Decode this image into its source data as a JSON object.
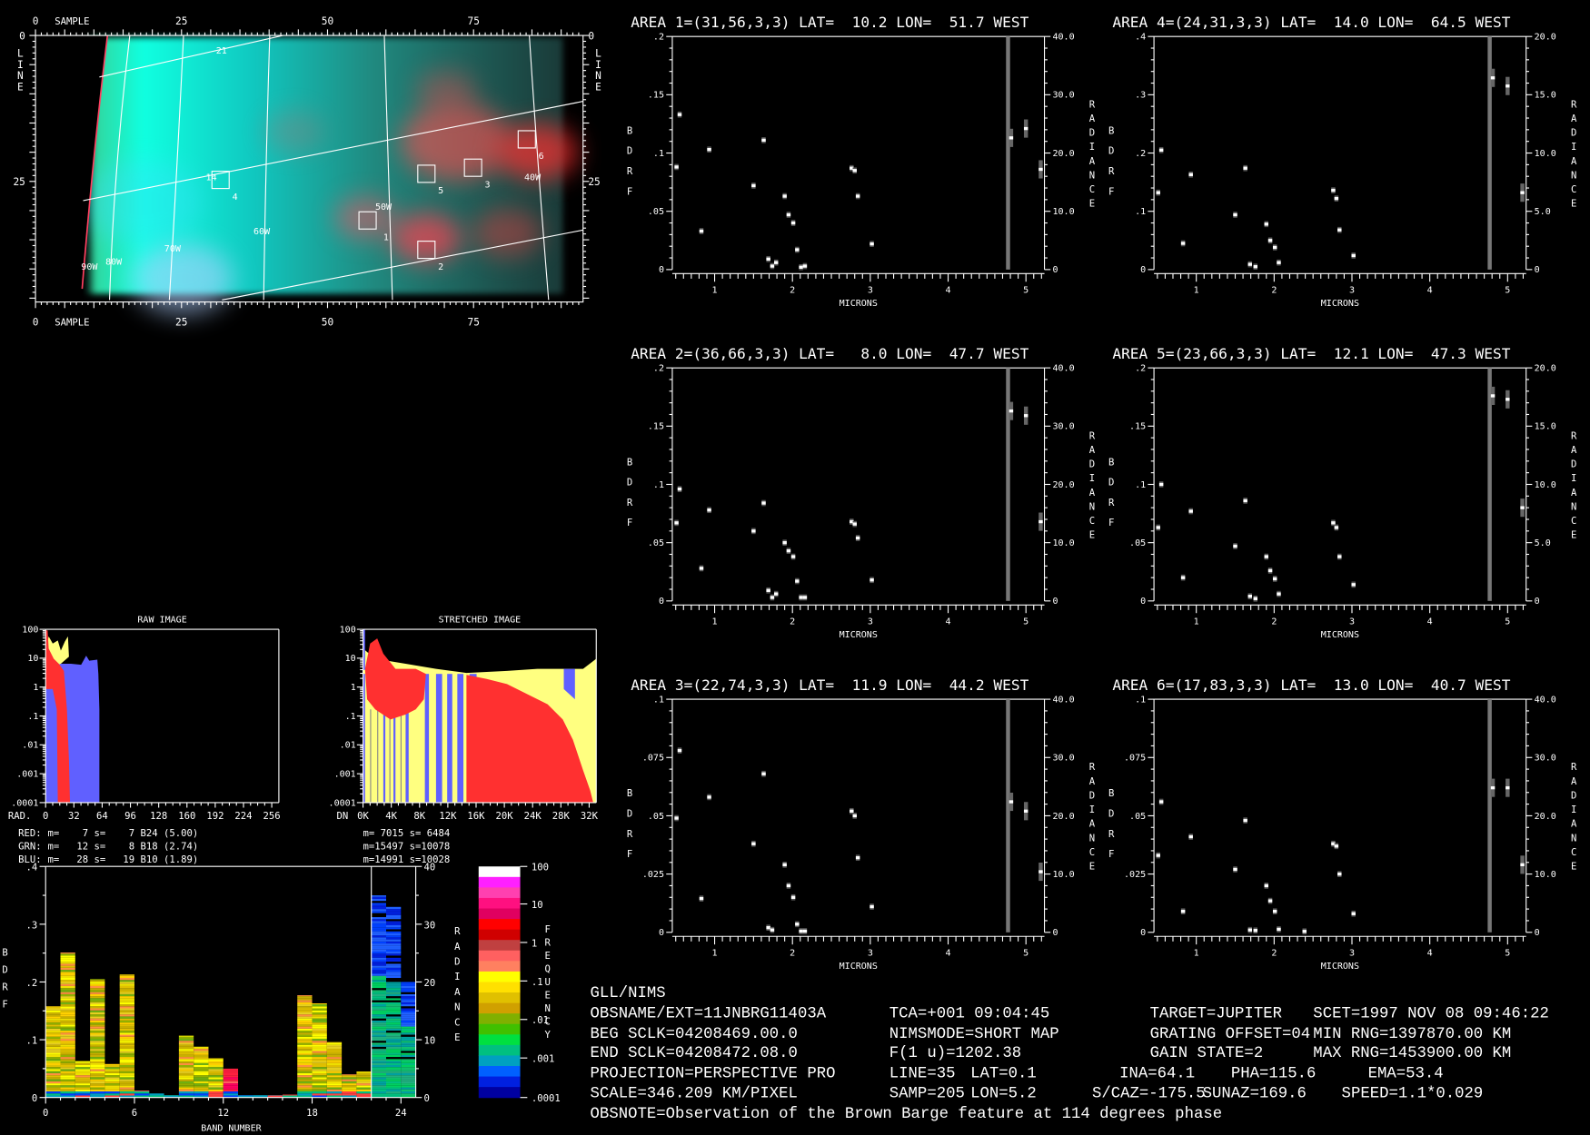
{
  "map": {
    "sample_label": "SAMPLE",
    "line_label": [
      "L",
      "I",
      "N",
      "E"
    ],
    "sample_ticks": [
      "0",
      "25",
      "50",
      "75"
    ],
    "line_ticks": [
      "0",
      "25"
    ],
    "lon_labels": [
      "90W",
      "80W",
      "70W",
      "60W",
      "50W",
      "40W"
    ],
    "lat_labels": [
      "21",
      "14"
    ],
    "areas": [
      "1",
      "2",
      "3",
      "4",
      "5",
      "6"
    ]
  },
  "spectra": {
    "xlabel": "MICRONS",
    "left_label": [
      "B",
      "D",
      "R",
      "F"
    ],
    "right_label": [
      "R",
      "A",
      "D",
      "I",
      "A",
      "N",
      "C",
      "E"
    ],
    "x_ticks": [
      "1",
      "2",
      "3",
      "4",
      "5"
    ],
    "thermal_band_micron": 4.77,
    "areas": [
      {
        "title": "AREA 1=(31,56,3,3) LAT=  10.2 LON=  51.7 WEST",
        "yticks": [
          "0",
          ".05",
          ".1",
          ".15",
          ".2"
        ],
        "ymax": 0.2,
        "rticks": [
          "0",
          "10.0",
          "20.0",
          "30.0",
          "40.0"
        ],
        "points": [
          [
            0.51,
            0.088
          ],
          [
            0.55,
            0.133
          ],
          [
            0.83,
            0.033
          ],
          [
            0.93,
            0.103
          ],
          [
            1.5,
            0.072
          ],
          [
            1.63,
            0.111
          ],
          [
            1.69,
            0.009
          ],
          [
            1.74,
            0.003
          ],
          [
            1.79,
            0.006
          ],
          [
            1.9,
            0.063
          ],
          [
            1.95,
            0.047
          ],
          [
            2.01,
            0.04
          ],
          [
            2.06,
            0.017
          ],
          [
            2.11,
            0.002
          ],
          [
            2.16,
            0.003
          ],
          [
            2.76,
            0.087
          ],
          [
            2.8,
            0.085
          ],
          [
            2.84,
            0.063
          ],
          [
            3.02,
            0.022
          ],
          [
            4.81,
            0.113
          ],
          [
            5.0,
            0.121
          ],
          [
            5.19,
            0.086
          ]
        ]
      },
      {
        "title": "AREA 2=(36,66,3,3) LAT=   8.0 LON=  47.7 WEST",
        "yticks": [
          "0",
          ".05",
          ".1",
          ".15",
          ".2"
        ],
        "ymax": 0.2,
        "rticks": [
          "0",
          "10.0",
          "20.0",
          "30.0",
          "40.0"
        ],
        "points": [
          [
            0.51,
            0.067
          ],
          [
            0.55,
            0.096
          ],
          [
            0.83,
            0.028
          ],
          [
            0.93,
            0.078
          ],
          [
            1.5,
            0.06
          ],
          [
            1.63,
            0.084
          ],
          [
            1.69,
            0.009
          ],
          [
            1.74,
            0.003
          ],
          [
            1.79,
            0.006
          ],
          [
            1.9,
            0.05
          ],
          [
            1.95,
            0.043
          ],
          [
            2.01,
            0.038
          ],
          [
            2.06,
            0.017
          ],
          [
            2.11,
            0.003
          ],
          [
            2.16,
            0.003
          ],
          [
            2.76,
            0.068
          ],
          [
            2.8,
            0.066
          ],
          [
            2.84,
            0.054
          ],
          [
            3.02,
            0.018
          ],
          [
            4.81,
            0.163
          ],
          [
            5.0,
            0.159
          ],
          [
            5.19,
            0.068
          ]
        ]
      },
      {
        "title": "AREA 3=(22,74,3,3) LAT=  11.9 LON=  44.2 WEST",
        "yticks": [
          "0",
          ".025",
          ".05",
          ".075",
          ".1"
        ],
        "ymax": 0.1,
        "rticks": [
          "0",
          "10.0",
          "20.0",
          "30.0",
          "40.0"
        ],
        "points": [
          [
            0.51,
            0.049
          ],
          [
            0.55,
            0.078
          ],
          [
            0.83,
            0.0145
          ],
          [
            0.93,
            0.058
          ],
          [
            1.5,
            0.038
          ],
          [
            1.63,
            0.068
          ],
          [
            1.69,
            0.002
          ],
          [
            1.74,
            0.001
          ],
          [
            1.9,
            0.029
          ],
          [
            1.95,
            0.02
          ],
          [
            2.01,
            0.015
          ],
          [
            2.06,
            0.0035
          ],
          [
            2.11,
            0.0005
          ],
          [
            2.16,
            0.0005
          ],
          [
            2.76,
            0.052
          ],
          [
            2.8,
            0.05
          ],
          [
            2.84,
            0.032
          ],
          [
            3.02,
            0.011
          ],
          [
            4.81,
            0.056
          ],
          [
            5.0,
            0.052
          ],
          [
            5.19,
            0.026
          ]
        ]
      },
      {
        "title": "AREA 4=(24,31,3,3) LAT=  14.0 LON=  64.5 WEST",
        "yticks": [
          "0",
          ".1",
          ".2",
          ".3",
          ".4"
        ],
        "ymax": 0.4,
        "rticks": [
          "0",
          "5.0",
          "10.0",
          "15.0",
          "20.0"
        ],
        "points": [
          [
            0.51,
            0.132
          ],
          [
            0.55,
            0.205
          ],
          [
            0.83,
            0.045
          ],
          [
            0.93,
            0.163
          ],
          [
            1.5,
            0.094
          ],
          [
            1.63,
            0.174
          ],
          [
            1.69,
            0.009
          ],
          [
            1.76,
            0.005
          ],
          [
            1.9,
            0.078
          ],
          [
            1.95,
            0.05
          ],
          [
            2.01,
            0.038
          ],
          [
            2.06,
            0.012
          ],
          [
            2.76,
            0.136
          ],
          [
            2.8,
            0.122
          ],
          [
            2.84,
            0.068
          ],
          [
            3.02,
            0.024
          ],
          [
            4.81,
            0.329
          ],
          [
            5.0,
            0.315
          ],
          [
            5.19,
            0.132
          ]
        ]
      },
      {
        "title": "AREA 5=(23,66,3,3) LAT=  12.1 LON=  47.3 WEST",
        "yticks": [
          "0",
          ".05",
          ".1",
          ".15",
          ".2"
        ],
        "ymax": 0.2,
        "rticks": [
          "0",
          "5.0",
          "10.0",
          "15.0",
          "20.0"
        ],
        "points": [
          [
            0.51,
            0.063
          ],
          [
            0.55,
            0.1
          ],
          [
            0.83,
            0.02
          ],
          [
            0.93,
            0.077
          ],
          [
            1.5,
            0.047
          ],
          [
            1.63,
            0.086
          ],
          [
            1.69,
            0.004
          ],
          [
            1.76,
            0.002
          ],
          [
            1.9,
            0.038
          ],
          [
            1.95,
            0.026
          ],
          [
            2.01,
            0.019
          ],
          [
            2.06,
            0.006
          ],
          [
            2.76,
            0.067
          ],
          [
            2.8,
            0.063
          ],
          [
            2.84,
            0.038
          ],
          [
            3.02,
            0.014
          ],
          [
            4.81,
            0.176
          ],
          [
            5.0,
            0.173
          ],
          [
            5.19,
            0.08
          ]
        ]
      },
      {
        "title": "AREA 6=(17,83,3,3) LAT=  13.0 LON=  40.7 WEST",
        "yticks": [
          "0",
          ".025",
          ".05",
          ".075",
          ".1"
        ],
        "ymax": 0.1,
        "rticks": [
          "0",
          "10.0",
          "20.0",
          "30.0",
          "40.0"
        ],
        "points": [
          [
            0.51,
            0.033
          ],
          [
            0.55,
            0.056
          ],
          [
            0.83,
            0.009
          ],
          [
            0.93,
            0.041
          ],
          [
            1.5,
            0.027
          ],
          [
            1.63,
            0.048
          ],
          [
            1.69,
            0.001
          ],
          [
            1.76,
            0.0008
          ],
          [
            1.9,
            0.02
          ],
          [
            1.95,
            0.0135
          ],
          [
            2.01,
            0.009
          ],
          [
            2.06,
            0.0013
          ],
          [
            2.39,
            0.0004
          ],
          [
            2.76,
            0.038
          ],
          [
            2.8,
            0.037
          ],
          [
            2.84,
            0.025
          ],
          [
            3.02,
            0.008
          ],
          [
            4.81,
            0.062
          ],
          [
            5.0,
            0.062
          ],
          [
            5.19,
            0.029
          ]
        ]
      }
    ]
  },
  "raw_hist": {
    "title": "RAW IMAGE",
    "y_ticks": [
      "100",
      "10",
      "1",
      ".1",
      ".01",
      ".001",
      ".0001"
    ],
    "x_unit": "RAD.",
    "x_ticks": [
      "0",
      "32",
      "64",
      "96",
      "128",
      "160",
      "192",
      "224",
      "256"
    ],
    "stats": [
      {
        "label": "RED:",
        "text": "m=    7 s=    7 B24 (5.00)",
        "color": "#ff3030"
      },
      {
        "label": "GRN:",
        "text": "m=   12 s=    8 B18 (2.74)",
        "color": "#ffff80"
      },
      {
        "label": "BLU:",
        "text": "m=   28 s=   19 B10 (1.89)",
        "color": "#6060ff"
      }
    ]
  },
  "stretched_hist": {
    "title": "STRETCHED IMAGE",
    "y_ticks": [
      "100",
      "10",
      "1",
      ".1",
      ".01",
      ".001",
      ".0001"
    ],
    "x_unit": "DN",
    "x_ticks": [
      "0K",
      "4K",
      "8K",
      "12K",
      "16K",
      "20K",
      "24K",
      "28K",
      "32K"
    ],
    "stats": [
      "m= 7015 s= 6484",
      "m=15497 s=10078",
      "m=14991 s=10028"
    ]
  },
  "band_chart": {
    "xlabel": "BAND NUMBER",
    "left_label": [
      "B",
      "D",
      "R",
      "F"
    ],
    "right_label": [
      "R",
      "A",
      "D",
      "I",
      "A",
      "N",
      "C",
      "E"
    ],
    "y_ticks": [
      "0",
      ".1",
      ".2",
      ".3",
      ".4"
    ],
    "r_ticks": [
      "0",
      "10",
      "20",
      "30",
      "40"
    ],
    "x_ticks": [
      "0",
      "6",
      "12",
      "18",
      "24"
    ],
    "bdrf_max": 0.4,
    "thermal_start_band": 22,
    "values": [
      0.158,
      0.251,
      0.063,
      0.205,
      0.058,
      0.213,
      0.012,
      0.007,
      0.004,
      0.107,
      0.088,
      0.068,
      0.05,
      0.004,
      0.004,
      0.004,
      0.005,
      0.177,
      0.163,
      0.096,
      0.04,
      0.045,
      0.35,
      0.33,
      0.2
    ]
  },
  "colorbar": {
    "label": [
      "F",
      "R",
      "E",
      "Q",
      "U",
      "E",
      "N",
      "C",
      "Y"
    ],
    "ticks": [
      "100",
      "10",
      "1",
      ".1",
      ".01",
      ".001",
      ".0001"
    ],
    "colors": [
      "#ffffff",
      "#ff20ff",
      "#ff40b0",
      "#ff1080",
      "#e00060",
      "#ff0000",
      "#d00000",
      "#c04040",
      "#ff6060",
      "#ff8060",
      "#ffff00",
      "#ffe000",
      "#e0c000",
      "#d0a000",
      "#80b000",
      "#40c000",
      "#00e040",
      "#00c080",
      "#00a0c0",
      "#0060ff",
      "#0020e0",
      "#0000a0"
    ]
  },
  "info": {
    "rows": [
      [
        {
          "x": 582,
          "t": "GLL/NIMS"
        }
      ],
      [
        {
          "x": 582,
          "t": "OBSNAME/EXT=11JNBRG11403A"
        },
        {
          "x": 877,
          "t": "TCA=+001 09:04:45"
        },
        {
          "x": 1134,
          "t": "TARGET=JUPITER"
        },
        {
          "x": 1295,
          "t": "SCET=1997 NOV 08 09:46:22"
        }
      ],
      [
        {
          "x": 582,
          "t": "BEG SCLK=04208469.00.0"
        },
        {
          "x": 877,
          "t": "NIMSMODE=SHORT MAP"
        },
        {
          "x": 1134,
          "t": "GRATING OFFSET=04"
        },
        {
          "x": 1295,
          "t": "MIN RNG=1397870.00 KM"
        }
      ],
      [
        {
          "x": 582,
          "t": "END SCLK=04208472.08.0"
        },
        {
          "x": 877,
          "t": "F(1 u)=1202.38"
        },
        {
          "x": 1134,
          "t": "GAIN STATE=2"
        },
        {
          "x": 1295,
          "t": "MAX RNG=1453900.00 KM"
        }
      ],
      [
        {
          "x": 582,
          "t": "PROJECTION=PERSPECTIVE PRO"
        },
        {
          "x": 877,
          "t": "LINE=35"
        },
        {
          "x": 957,
          "t": "LAT=0.1"
        },
        {
          "x": 1104,
          "t": "INA=64.1"
        },
        {
          "x": 1214,
          "t": "PHA=115.6"
        },
        {
          "x": 1349,
          "t": "EMA=53.4"
        }
      ],
      [
        {
          "x": 582,
          "t": "SCALE=346.209 KM/PIXEL"
        },
        {
          "x": 877,
          "t": "SAMP=205"
        },
        {
          "x": 957,
          "t": "LON=5.2"
        },
        {
          "x": 1077,
          "t": "S/CAZ=-175.5"
        },
        {
          "x": 1186,
          "t": "SUNAZ=169.6"
        },
        {
          "x": 1323,
          "t": "SPEED=1.1*0.029"
        }
      ],
      [
        {
          "x": 582,
          "t": "OBSNOTE=Observation of the Brown Barge feature at 114 degrees phase"
        }
      ]
    ]
  }
}
